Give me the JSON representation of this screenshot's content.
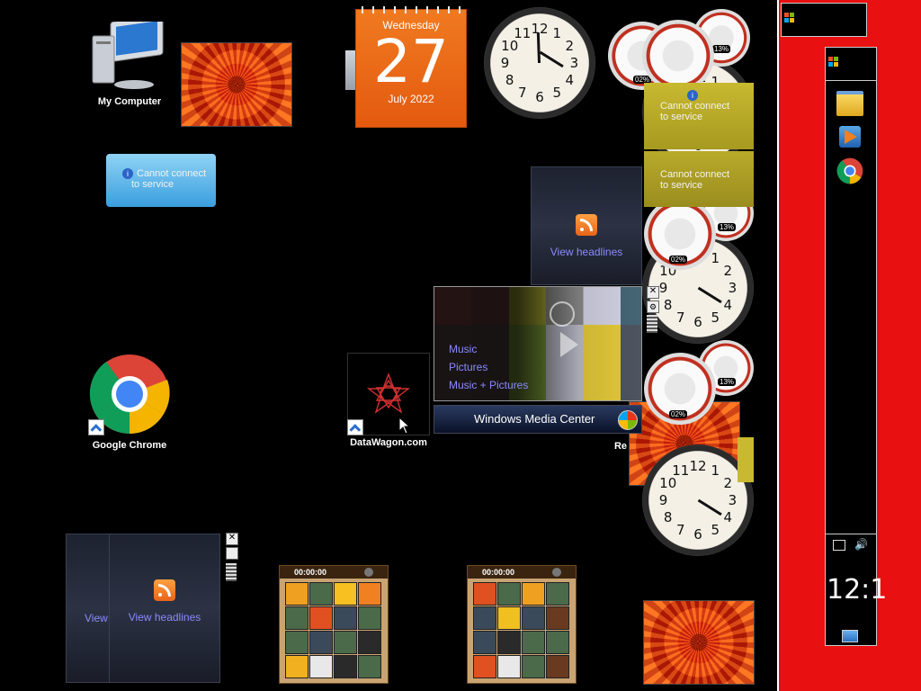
{
  "desktop": {
    "icons": [
      {
        "label": "My Computer",
        "icon": "computer-icon"
      },
      {
        "label": "Google Chrome",
        "icon": "chrome-icon"
      },
      {
        "label": "DataWagon.com",
        "icon": "datawagon-icon"
      },
      {
        "label": "Re",
        "icon": "recycle-bin-icon"
      }
    ]
  },
  "gadgets": {
    "calendar": {
      "weekday": "Wednesday",
      "day": "27",
      "month_year": "July 2022"
    },
    "weather_left": {
      "line1": "Cannot connect",
      "line2": "to service"
    },
    "weather_right_1": {
      "line1": "Cannot connect",
      "line2": "to service"
    },
    "weather_right_2": {
      "line1": "Cannot connect",
      "line2": "to service"
    },
    "feed_middle": {
      "label": "View headlines"
    },
    "feed_bottom": {
      "label_back": "View",
      "label_front": "View headlines"
    },
    "media_center": {
      "items": [
        "Music",
        "Pictures",
        "Music + Pictures"
      ],
      "title": "Windows Media Center"
    },
    "cpu_meters": [
      {
        "cpu": "02%",
        "mem": "13%"
      },
      {
        "cpu": "02%",
        "mem": "13%"
      },
      {
        "cpu": "02%",
        "mem": "13%"
      }
    ],
    "puzzles": [
      {
        "timer": "00:00:00"
      },
      {
        "timer": "00:00:00"
      }
    ],
    "clock_numbers": [
      "12",
      "1",
      "2",
      "3",
      "4",
      "5",
      "6",
      "7",
      "8",
      "9",
      "10",
      "11"
    ]
  },
  "taskbar": {
    "clock": "12:1",
    "pinned": [
      "windows-explorer-icon",
      "media-player-icon",
      "chrome-icon"
    ]
  },
  "colors": {
    "sidebar": "#e81010",
    "calendar": "#e8661a",
    "feed_link": "#8a8aff"
  }
}
